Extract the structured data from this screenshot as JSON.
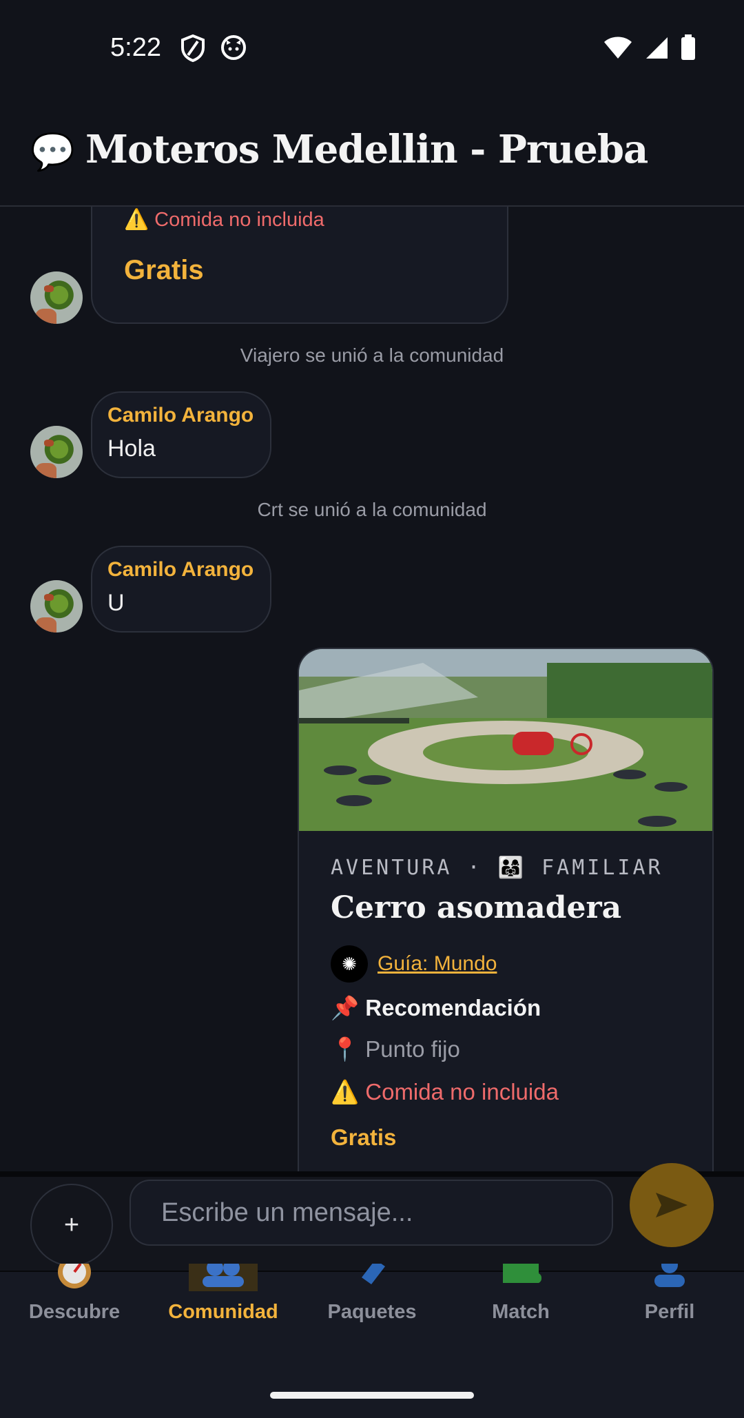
{
  "status_bar": {
    "time": "5:22",
    "left_icons": [
      "shield-icon",
      "cat-icon"
    ],
    "right_icons": [
      "wifi-icon",
      "signal-icon",
      "battery-icon"
    ]
  },
  "header": {
    "icon": "speech-bubble-icon",
    "title": "Moteros Medellin - Prueba"
  },
  "messages": {
    "top_card": {
      "warning": "⚠️ Comida no incluida",
      "price": "Gratis"
    },
    "system1": "Viajero se unió a la comunidad",
    "msg1": {
      "sender": "Camilo Arango",
      "text": "Hola"
    },
    "system2": "Crt se unió a la comunidad",
    "msg2": {
      "sender": "Camilo Arango",
      "text": "U"
    },
    "card": {
      "category": "AVENTURA · 👨‍👩‍👧 FAMILIAR",
      "title": "Cerro asomadera",
      "guide": "Guía: Mundo",
      "recommendation": "📌 Recomendación",
      "location": "📍 Punto fijo",
      "warning": "⚠️ Comida no incluida",
      "price": "Gratis"
    }
  },
  "input": {
    "placeholder": "Escribe un mensaje...",
    "attach_label": "+"
  },
  "nav": {
    "items": [
      {
        "label": "Descubre",
        "icon": "compass-icon"
      },
      {
        "label": "Comunidad",
        "icon": "people-icon",
        "active": true
      },
      {
        "label": "Paquetes",
        "icon": "book-icon"
      },
      {
        "label": "Match",
        "icon": "puzzle-icon"
      },
      {
        "label": "Perfil",
        "icon": "user-icon"
      }
    ]
  },
  "colors": {
    "accent": "#f3b33c",
    "warning": "#ef6b6b",
    "background": "#11131a"
  }
}
